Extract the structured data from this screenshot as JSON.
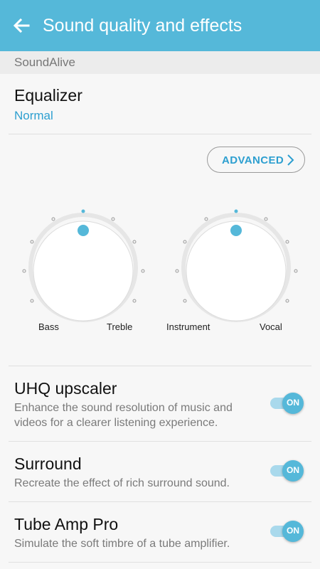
{
  "header": {
    "title": "Sound quality and effects",
    "back_icon": "arrow-back-icon"
  },
  "section": {
    "label": "SoundAlive"
  },
  "equalizer": {
    "title": "Equalizer",
    "value": "Normal",
    "advanced_label": "ADVANCED",
    "knob1": {
      "left_label": "Bass",
      "right_label": "Treble"
    },
    "knob2": {
      "left_label": "Instrument",
      "right_label": "Vocal"
    }
  },
  "settings": [
    {
      "title": "UHQ upscaler",
      "subtitle_line1": "Enhance the sound resolution of music and",
      "subtitle_line2": "videos for a clearer listening experience.",
      "toggle": "ON"
    },
    {
      "title": "Surround",
      "subtitle_line1": "Recreate the effect of rich surround sound.",
      "toggle": "ON"
    },
    {
      "title": "Tube Amp Pro",
      "subtitle_line1": "Simulate the soft timbre of a tube amplifier.",
      "toggle": "ON"
    }
  ],
  "colors": {
    "accent": "#55b8d9",
    "link": "#2d9fd0",
    "background": "#f7f7f7"
  }
}
